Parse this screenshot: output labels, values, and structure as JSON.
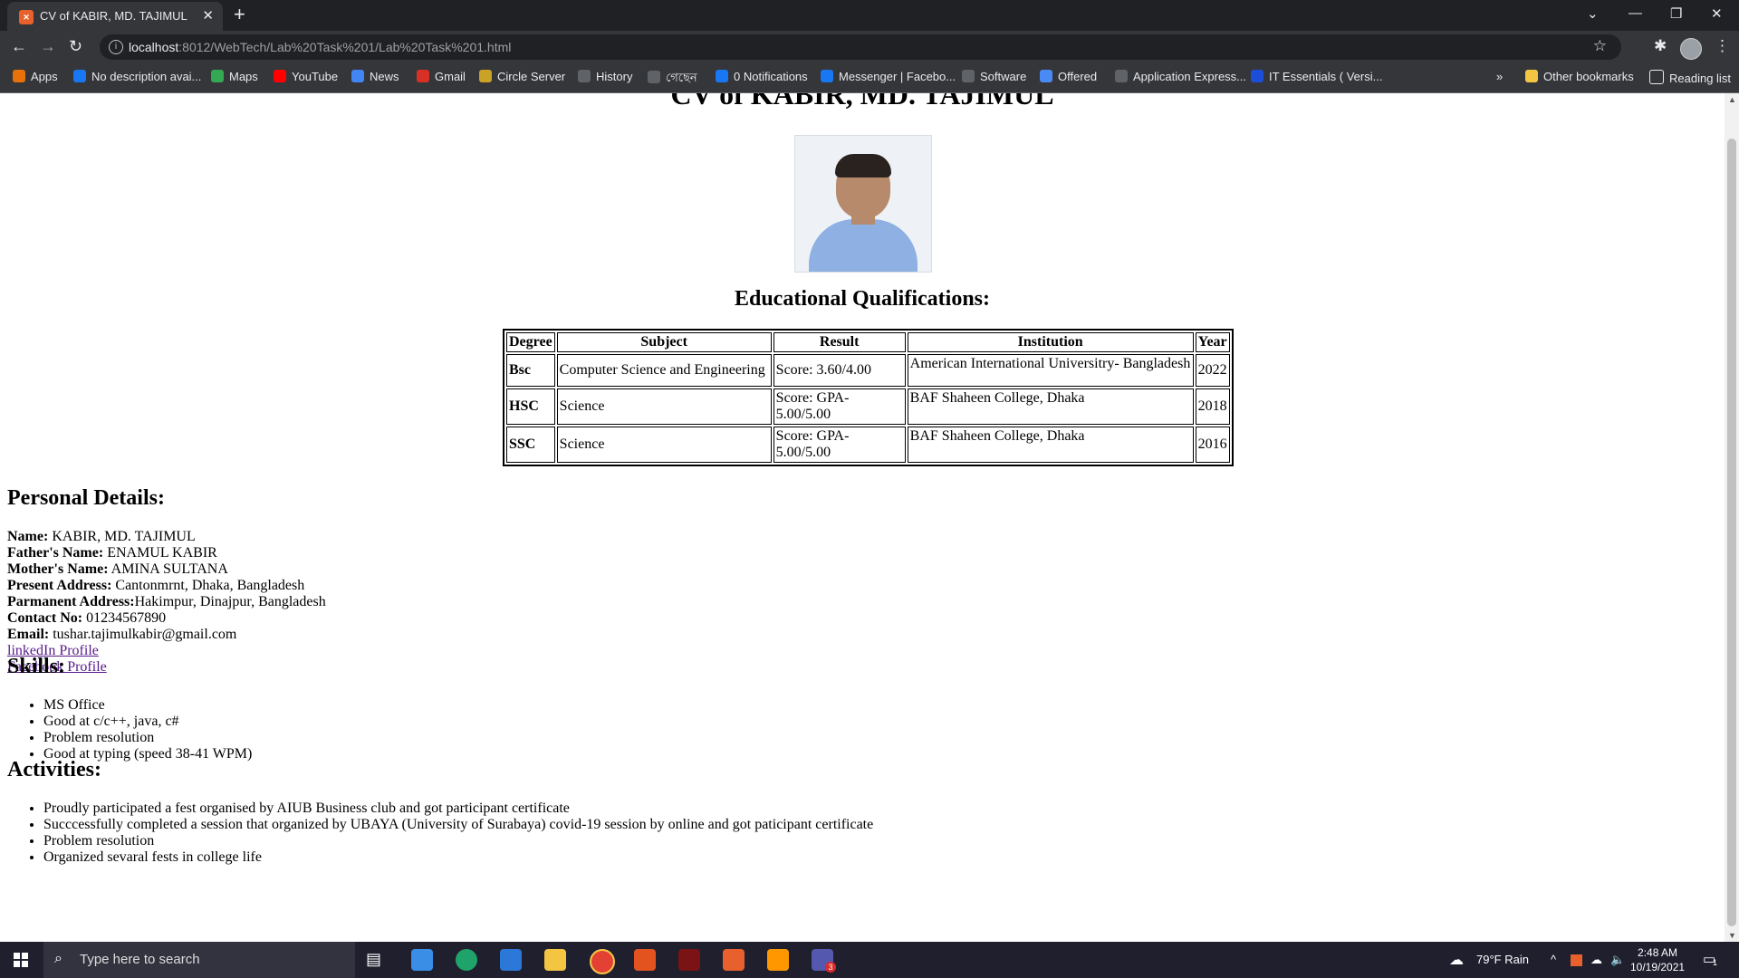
{
  "browser": {
    "tab_title": "CV of KABIR, MD. TAJIMUL",
    "tab_icon": "xampp-icon",
    "url_host": "localhost",
    "url_path": ":8012/WebTech/Lab%20Task%201/Lab%20Task%201.html",
    "bookmarks": [
      {
        "label": "Apps",
        "icon": "apps-grid-icon"
      },
      {
        "label": "No description avai...",
        "icon": "facebook-icon"
      },
      {
        "label": "Maps",
        "icon": "maps-icon"
      },
      {
        "label": "YouTube",
        "icon": "youtube-icon"
      },
      {
        "label": "News",
        "icon": "news-icon"
      },
      {
        "label": "Gmail",
        "icon": "gmail-icon"
      },
      {
        "label": "Circle Server",
        "icon": "circle-server-icon"
      },
      {
        "label": "History",
        "icon": "history-icon"
      },
      {
        "label": "গেছেন",
        "icon": "globe-icon"
      },
      {
        "label": "0 Notifications",
        "icon": "facebook-icon"
      },
      {
        "label": "Messenger | Facebo...",
        "icon": "facebook-icon"
      },
      {
        "label": "Software",
        "icon": "globe-icon"
      },
      {
        "label": "Offered",
        "icon": "shield-icon"
      },
      {
        "label": "Application Express...",
        "icon": "globe-icon"
      },
      {
        "label": "IT Essentials ( Versi...",
        "icon": "cisco-icon"
      }
    ],
    "more_label": "»",
    "other_bookmarks": "Other bookmarks",
    "reading_list": "Reading list"
  },
  "page": {
    "title": "CV of KABIR, MD. TAJIMUL",
    "edu_heading": "Educational Qualifications:",
    "edu_table": {
      "headers": [
        "Degree",
        "Subject",
        "Result",
        "Institution",
        "Year"
      ],
      "rows": [
        {
          "degree": "Bsc",
          "subject": "Computer Science and Engineering",
          "result": "Score: 3.60/4.00",
          "institution": "American International Universitry- Bangladesh",
          "year": "2022"
        },
        {
          "degree": "HSC",
          "subject": "Science",
          "result": "Score: GPA-5.00/5.00",
          "institution": "BAF Shaheen College, Dhaka",
          "year": "2018"
        },
        {
          "degree": "SSC",
          "subject": "Science",
          "result": "Score: GPA-5.00/5.00",
          "institution": "BAF Shaheen College, Dhaka",
          "year": "2016"
        }
      ]
    },
    "personal_heading": "Personal Details:",
    "personal": {
      "name_label": "Name:",
      "name": " KABIR, MD. TAJIMUL",
      "father_label": "Father's Name:",
      "father": " ENAMUL KABIR",
      "mother_label": "Mother's Name:",
      "mother": " AMINA SULTANA",
      "present_label": "Present Address:",
      "present": " Cantonmrnt, Dhaka, Bangladesh",
      "permanent_label": "Parmanent Address:",
      "permanent": "Hakimpur, Dinajpur, Bangladesh",
      "contact_label": "Contact No:",
      "contact": " 01234567890",
      "email_label": "Email:",
      "email": " tushar.tajimulkabir@gmail.com",
      "linkedin": "linkedIn Profile",
      "facebook": "Facebook Profile"
    },
    "skills_heading": "Skills:",
    "skills": [
      "MS Office",
      "Good at c/c++, java, c#",
      "Problem resolution",
      "Good at typing (speed 38-41 WPM)"
    ],
    "activities_heading": "Activities:",
    "activities": [
      "Proudly participated a fest organised by AIUB Business club and got participant certificate",
      "Succcessfully completed a session that organized by UBAYA (University of Surabaya) covid-19 session by online and got paticipant certificate",
      "Problem resolution",
      "Organized sevaral fests in college life"
    ]
  },
  "taskbar": {
    "search_placeholder": "Type here to search",
    "weather": "79°F  Rain",
    "time": "2:48 AM",
    "date": "10/19/2021",
    "notification_count": "1",
    "teams_badge": "3"
  }
}
